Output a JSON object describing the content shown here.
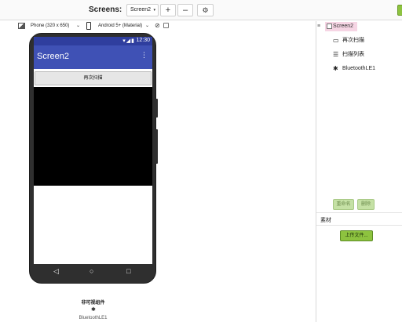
{
  "toolbar": {
    "screens_label": "Screens:",
    "screen_select_value": "Screen2",
    "add_screen_label": "+",
    "remove_screen_label": "–",
    "settings_icon": "gear-icon"
  },
  "viewer": {
    "device_select_value": "Phone (320 x 650)",
    "theme_select_value": "Android 5+ (Material)",
    "hidden_components_icon": "eye-slash-icon"
  },
  "phone": {
    "status_icons": "▾◢▮",
    "status_time": "12:30",
    "app_title": "Screen2",
    "overflow_icon": "⋮",
    "rescan_button_label": "再次扫描",
    "nav_back": "◁",
    "nav_home": "○",
    "nav_recent": "□"
  },
  "nonvisible": {
    "title": "非可视组件",
    "bt_icon": "✱",
    "bt_label": "BluetoothLE1"
  },
  "components": {
    "collapse_icon": "≡",
    "root_label": "Screen2",
    "items": [
      {
        "label": "再次扫描",
        "icon": "▭"
      },
      {
        "label": "扫描列表",
        "icon": "☰"
      },
      {
        "label": "BluetoothLE1",
        "icon": "✱"
      }
    ],
    "rename_label": "重命名",
    "delete_label": "删除"
  },
  "media": {
    "title": "素材",
    "upload_label": "上传文件..."
  },
  "colors": {
    "statusbar": "#2f3e9e",
    "appbar": "#3f51b5",
    "accent_green": "#8dc33f",
    "selected_pink": "#f6d5e4"
  }
}
